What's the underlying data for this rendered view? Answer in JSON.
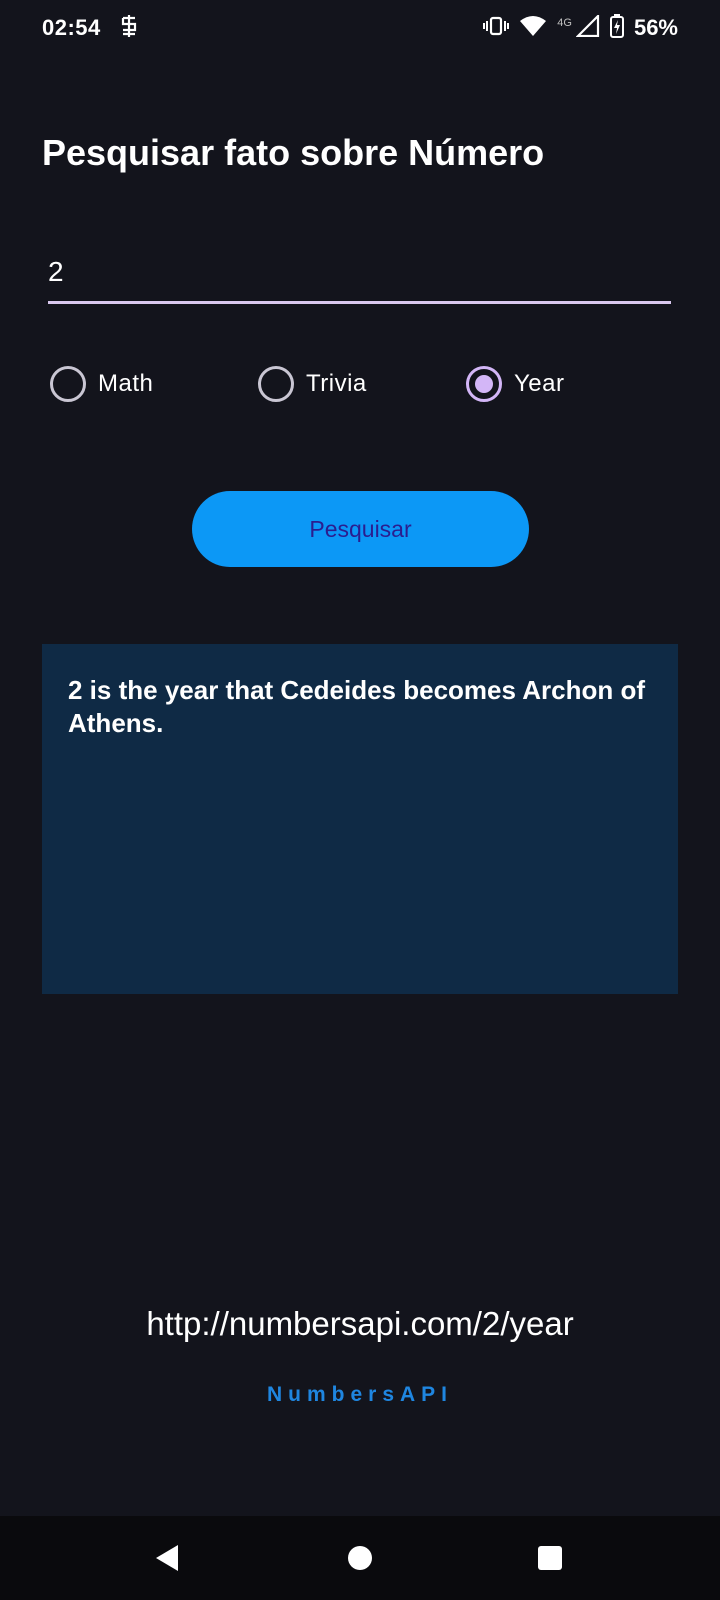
{
  "status_bar": {
    "time": "02:54",
    "network_label": "4G",
    "battery": "56%",
    "icons": [
      "notification-icon",
      "vibrate-icon",
      "wifi-icon",
      "signal-icon",
      "battery-icon"
    ]
  },
  "page": {
    "title": "Pesquisar fato sobre Número"
  },
  "number_input": {
    "value": "2"
  },
  "radio_options": {
    "math": "Math",
    "trivia": "Trivia",
    "year": "Year",
    "selected": "Year"
  },
  "search_button": {
    "label": "Pesquisar"
  },
  "result": {
    "text": "2 is the year that Cedeides becomes Archon of Athens."
  },
  "footer": {
    "url": "http://numbersapi.com/2/year",
    "brand": "NumbersAPI"
  },
  "nav_bar": {
    "icons": [
      "back-icon",
      "home-icon",
      "recents-icon"
    ]
  },
  "colors": {
    "background": "#13141c",
    "accent": "#0c98f6",
    "radio_selected": "#d3b6f7",
    "card": "#0f2a45",
    "brand": "#1f86e0"
  }
}
